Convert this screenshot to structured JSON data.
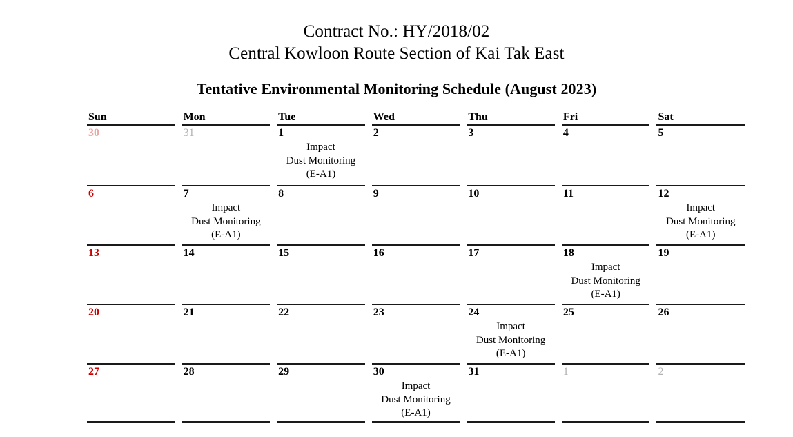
{
  "header": {
    "contract_no": "Contract No.: HY/2018/02",
    "project_name": "Central Kowloon Route Section of Kai Tak East",
    "schedule_title": "Tentative Environmental Monitoring Schedule (August 2023)"
  },
  "colors": {
    "sunday_shade": "#e8e8e8",
    "sunday_date": "#cc0000",
    "sunday_date_muted": "#eda6a6",
    "outside_month_date": "#b3b3b3",
    "border": "#1a1a1a",
    "text": "#000000",
    "background": "#ffffff"
  },
  "calendar": {
    "month": "August 2023",
    "daynames": [
      "Sun",
      "Mon",
      "Tue",
      "Wed",
      "Thu",
      "Fri",
      "Sat"
    ],
    "event_lines": [
      "Impact",
      "Dust Monitoring",
      "(E-A1)"
    ],
    "weeks": [
      [
        {
          "date": "30",
          "in_month": false,
          "event": null
        },
        {
          "date": "31",
          "in_month": false,
          "event": null
        },
        {
          "date": "1",
          "in_month": true,
          "event": [
            "Impact",
            "Dust Monitoring",
            "(E-A1)"
          ]
        },
        {
          "date": "2",
          "in_month": true,
          "event": null
        },
        {
          "date": "3",
          "in_month": true,
          "event": null
        },
        {
          "date": "4",
          "in_month": true,
          "event": null
        },
        {
          "date": "5",
          "in_month": true,
          "event": null
        }
      ],
      [
        {
          "date": "6",
          "in_month": true,
          "event": null
        },
        {
          "date": "7",
          "in_month": true,
          "event": [
            "Impact",
            "Dust Monitoring",
            "(E-A1)"
          ]
        },
        {
          "date": "8",
          "in_month": true,
          "event": null
        },
        {
          "date": "9",
          "in_month": true,
          "event": null
        },
        {
          "date": "10",
          "in_month": true,
          "event": null
        },
        {
          "date": "11",
          "in_month": true,
          "event": null
        },
        {
          "date": "12",
          "in_month": true,
          "event": [
            "Impact",
            "Dust Monitoring",
            "(E-A1)"
          ]
        }
      ],
      [
        {
          "date": "13",
          "in_month": true,
          "event": null
        },
        {
          "date": "14",
          "in_month": true,
          "event": null
        },
        {
          "date": "15",
          "in_month": true,
          "event": null
        },
        {
          "date": "16",
          "in_month": true,
          "event": null
        },
        {
          "date": "17",
          "in_month": true,
          "event": null
        },
        {
          "date": "18",
          "in_month": true,
          "event": [
            "Impact",
            "Dust Monitoring",
            "(E-A1)"
          ]
        },
        {
          "date": "19",
          "in_month": true,
          "event": null
        }
      ],
      [
        {
          "date": "20",
          "in_month": true,
          "event": null
        },
        {
          "date": "21",
          "in_month": true,
          "event": null
        },
        {
          "date": "22",
          "in_month": true,
          "event": null
        },
        {
          "date": "23",
          "in_month": true,
          "event": null
        },
        {
          "date": "24",
          "in_month": true,
          "event": [
            "Impact",
            "Dust Monitoring",
            "(E-A1)"
          ]
        },
        {
          "date": "25",
          "in_month": true,
          "event": null
        },
        {
          "date": "26",
          "in_month": true,
          "event": null
        }
      ],
      [
        {
          "date": "27",
          "in_month": true,
          "event": null
        },
        {
          "date": "28",
          "in_month": true,
          "event": null
        },
        {
          "date": "29",
          "in_month": true,
          "event": null
        },
        {
          "date": "30",
          "in_month": true,
          "event": [
            "Impact",
            "Dust Monitoring",
            "(E-A1)"
          ]
        },
        {
          "date": "31",
          "in_month": true,
          "event": null
        },
        {
          "date": "1",
          "in_month": false,
          "event": null
        },
        {
          "date": "2",
          "in_month": false,
          "event": null
        }
      ]
    ]
  }
}
